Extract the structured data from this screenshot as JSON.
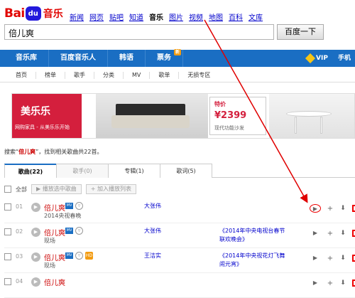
{
  "logo": {
    "bai": "Bai",
    "paw": "du",
    "music": "音乐"
  },
  "topnav": [
    "新闻",
    "网页",
    "贴吧",
    "知道",
    "音乐",
    "图片",
    "视频",
    "地图",
    "百科",
    "文库"
  ],
  "topnav_current": "音乐",
  "search": {
    "value": "倍儿爽",
    "button": "百度一下"
  },
  "mainnav": [
    {
      "label": "音乐库"
    },
    {
      "label": "百度音乐人"
    },
    {
      "label": "韩语"
    },
    {
      "label": "票务",
      "badge": "新"
    }
  ],
  "vip": "VIP",
  "mobile": "手机",
  "subnav": [
    "首页",
    "榜单",
    "歌手",
    "分类",
    "MV",
    "歌单",
    "无损专区"
  ],
  "banner": {
    "brand_name": "美乐乐",
    "brand_slogan": "网购家具 - 从美乐乐开始",
    "promo_tag": "特价",
    "promo_price": "¥2399",
    "promo_desc": "现代功能沙发"
  },
  "result": {
    "prefix": "搜索“",
    "keyword": "倍儿爽",
    "suffix": "”，找到相关歌曲共22首。"
  },
  "tabs": [
    {
      "label": "歌曲(22)",
      "state": "active"
    },
    {
      "label": "歌手(0)",
      "state": "inactive"
    },
    {
      "label": "专辑(1)",
      "state": "normal"
    },
    {
      "label": "歌词(5)",
      "state": "normal"
    }
  ],
  "toolbar": {
    "all": "全部",
    "play_selected": "播放选中歌曲",
    "add_list": "加入播放列表"
  },
  "songs": [
    {
      "num": "01",
      "title": "倍儿爽",
      "sub": "2014央视春晚",
      "artist": "大张伟",
      "album": "",
      "hd": false
    },
    {
      "num": "02",
      "title": "倍儿爽",
      "sub": "现场",
      "artist": "大张伟",
      "album": "《2014年中央电视台春节联欢晚会》",
      "hd": false
    },
    {
      "num": "03",
      "title": "倍儿爽",
      "sub": "现场",
      "artist": "王洁实",
      "album": "《2014年中央视花灯飞舞闹元宵》",
      "hd": true
    },
    {
      "num": "04",
      "title": "倍儿爽",
      "sub": "",
      "artist": "",
      "album": "",
      "hd": false
    }
  ],
  "icons": {
    "mv": "MV",
    "hd": "HD",
    "more": "▿",
    "play": "▶",
    "add": "+",
    "download": "⬇"
  },
  "colors": {
    "brand_red": "#e10602",
    "nav_blue": "#1a6ec3",
    "annotation_red": "#e00000"
  }
}
